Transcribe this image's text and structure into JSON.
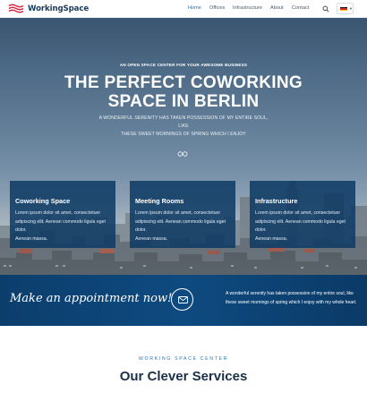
{
  "brand": {
    "name": "WorkingSpace",
    "accent": "#2376b7",
    "dark": "#173a5c"
  },
  "nav": {
    "items": [
      {
        "label": "Home",
        "active": true
      },
      {
        "label": "Offices",
        "active": false
      },
      {
        "label": "Infrastructure",
        "active": false
      },
      {
        "label": "About",
        "active": false
      },
      {
        "label": "Contact",
        "active": false
      }
    ],
    "search_icon": "search-icon",
    "language": {
      "flag": "german-flag",
      "icon": "chevron-down-icon"
    }
  },
  "hero": {
    "eyebrow": "AN OPEN SPACE CENTER FOR YOUR AWESOME BUSINESS",
    "title_line1": "THE PERFECT COWORKING",
    "title_line2": "SPACE IN BERLIN",
    "subtitle_line1": "A WONDERFUL SERENITY HAS TAKEN POSSESSION OF MY ENTIRE SOUL, LIKE",
    "subtitle_line2": "THESE SWEET MORNINGS OF SPRING WHICH I ENJOY",
    "slider_icon": "infinity-icon"
  },
  "cards": [
    {
      "title": "Coworking Space",
      "line1": "Lorem ipsum dolor sit amet, consectetuer",
      "line2": "adipiscing elit. Aenean commodo ligula eget dolor.",
      "line3": "Aenean massa."
    },
    {
      "title": "Meeting Rooms",
      "line1": "Lorem ipsum dolor sit amet, consectetuer",
      "line2": "adipiscing elit. Aenean commodo ligula eget dolor.",
      "line3": "Aenean massa."
    },
    {
      "title": "Infrastructure",
      "line1": "Lorem ipsum dolor sit amet, consectetuer",
      "line2": "adipiscing elit. Aenean commodo ligula eget dolor.",
      "line3": "Aenean massa."
    }
  ],
  "appointment": {
    "title": "Make an appointment now!",
    "icon": "envelope-icon",
    "line1": "A wonderful serenity has taken possession of my entire soul, like",
    "line2": "these sweet mornings of spring which I enjoy with my whole heart."
  },
  "services": {
    "eyebrow": "WORKING SPACE CENTER",
    "title": "Our Clever Services"
  }
}
